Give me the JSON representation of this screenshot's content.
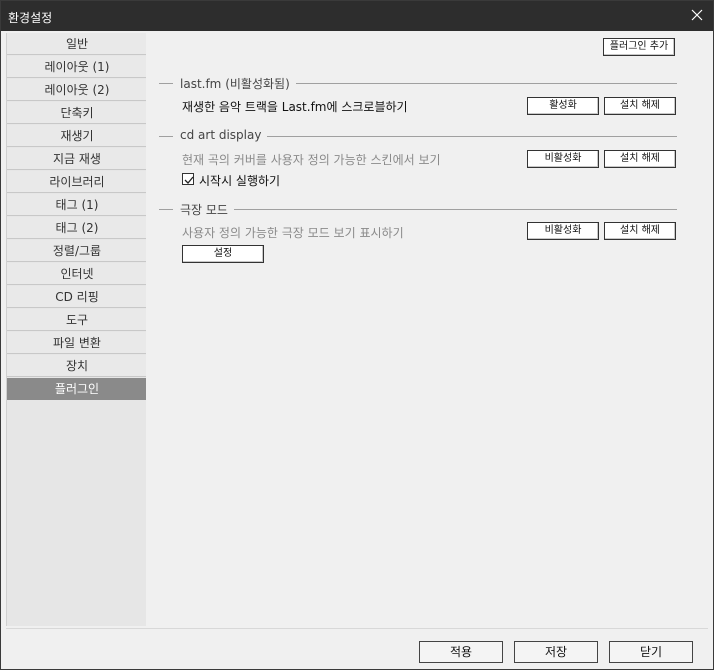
{
  "window": {
    "title": "환경설정"
  },
  "sidebar": {
    "items": [
      {
        "label": "일반"
      },
      {
        "label": "레이아웃 (1)"
      },
      {
        "label": "레이아웃 (2)"
      },
      {
        "label": "단축키"
      },
      {
        "label": "재생기"
      },
      {
        "label": "지금 재생"
      },
      {
        "label": "라이브러리"
      },
      {
        "label": "태그 (1)"
      },
      {
        "label": "태그 (2)"
      },
      {
        "label": "정렬/그룹"
      },
      {
        "label": "인터넷"
      },
      {
        "label": "CD 리핑"
      },
      {
        "label": "도구"
      },
      {
        "label": "파일 변환"
      },
      {
        "label": "장치"
      },
      {
        "label": "플러그인"
      }
    ],
    "selected": "플러그인"
  },
  "plugins": {
    "add_button": "플러그인 추가",
    "items": [
      {
        "name": "last.fm (비활성화됨)",
        "description": "재생한 음악 트랙을 Last.fm에 스크로블하기",
        "toggle_label": "활성화",
        "uninstall_label": "설치 해제",
        "enabled": false
      },
      {
        "name": "cd art display",
        "description": "현재 곡의 커버를 사용자 정의 가능한 스킨에서 보기",
        "toggle_label": "비활성화",
        "uninstall_label": "설치 해제",
        "enabled": true,
        "checkbox": {
          "label": "시작시 실행하기",
          "checked": true
        }
      },
      {
        "name": "극장 모드",
        "description": "사용자 정의 가능한 극장 모드 보기 표시하기",
        "toggle_label": "비활성화",
        "uninstall_label": "설치 해제",
        "enabled": true,
        "settings_label": "설정"
      }
    ]
  },
  "footer": {
    "apply": "적용",
    "save": "저장",
    "close": "닫기"
  }
}
